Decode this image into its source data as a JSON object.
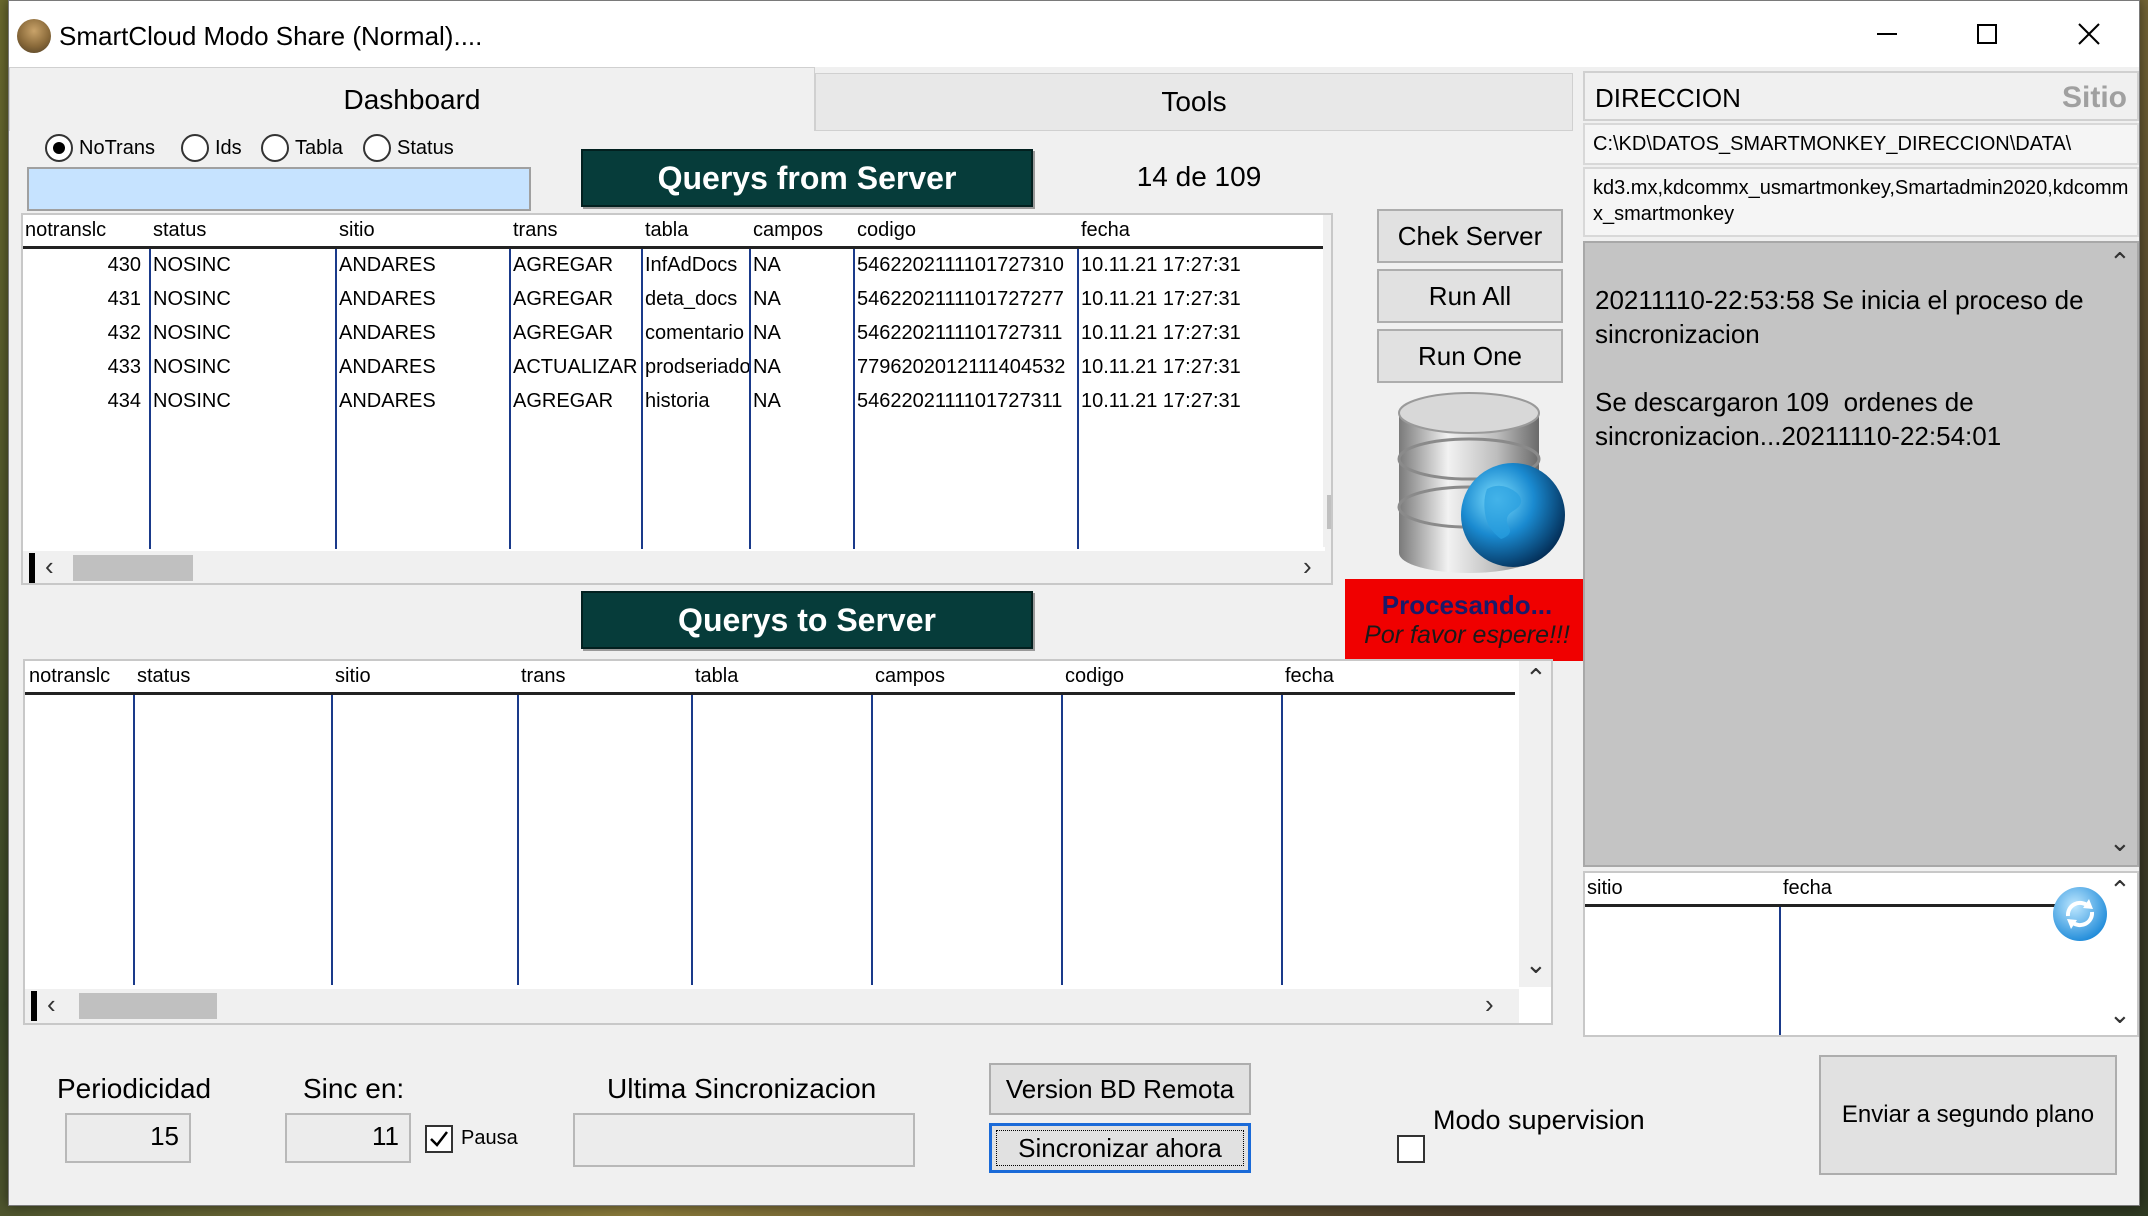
{
  "window": {
    "title": "SmartCloud Modo Share (Normal)...."
  },
  "tabs": [
    {
      "label": "Dashboard",
      "active": true
    },
    {
      "label": "Tools",
      "active": false
    }
  ],
  "filter": {
    "options": [
      "NoTrans",
      "Ids",
      "Tabla",
      "Status"
    ],
    "selected": "NoTrans",
    "input_value": ""
  },
  "from_server": {
    "title": "Querys from Server",
    "count_text": "14 de 109",
    "columns": [
      "notranslc",
      "status",
      "sitio",
      "trans",
      "tabla",
      "campos",
      "codigo",
      "fecha"
    ],
    "rows": [
      [
        "430",
        "NOSINC",
        "ANDARES",
        "AGREGAR",
        "InfAdDocs",
        "NA",
        "5462202111101727310",
        "10.11.21 17:27:31"
      ],
      [
        "431",
        "NOSINC",
        "ANDARES",
        "AGREGAR",
        "deta_docs",
        "NA",
        "5462202111101727277",
        "10.11.21 17:27:31"
      ],
      [
        "432",
        "NOSINC",
        "ANDARES",
        "AGREGAR",
        "comentario",
        "NA",
        "5462202111101727311",
        "10.11.21 17:27:31"
      ],
      [
        "433",
        "NOSINC",
        "ANDARES",
        "ACTUALIZAR",
        "prodseriado",
        "NA",
        "7796202012111404532",
        "10.11.21 17:27:31"
      ],
      [
        "434",
        "NOSINC",
        "ANDARES",
        "AGREGAR",
        "historia",
        "NA",
        "5462202111101727311",
        "10.11.21 17:27:31"
      ]
    ]
  },
  "to_server": {
    "title": "Querys to Server",
    "columns": [
      "notranslc",
      "status",
      "sitio",
      "trans",
      "tabla",
      "campos",
      "codigo",
      "fecha"
    ],
    "rows": []
  },
  "actions": {
    "check_server": "Chek Server",
    "run_all": "Run All",
    "run_one": "Run One"
  },
  "processing": {
    "title": "Procesando...",
    "subtitle": "Por favor espere!!!"
  },
  "right_panel": {
    "direction_label": "DIRECCION",
    "site_label": "Sitio",
    "data_path": "C:\\KD\\DATOS_SMARTMONKEY_DIRECCION\\DATA\\",
    "connection": "kd3.mx,kdcommx_usmartmonkey,Smartadmin2020,kdcommx_smartmonkey",
    "log": "20211110-22:53:58 Se inicia el proceso de sincronizacion\n\nSe descargaron 109  ordenes de sincronizacion...20211110-22:54:01",
    "small_grid_columns": [
      "sitio",
      "fecha"
    ]
  },
  "bottom": {
    "periodicity_label": "Periodicidad",
    "periodicity_value": "15",
    "sync_in_label": "Sinc en:",
    "sync_in_value": "11",
    "pause_label": "Pausa",
    "pause_checked": true,
    "last_sync_label": "Ultima Sincronizacion",
    "last_sync_value": "",
    "version_button": "Version BD Remota",
    "sync_now_button": "Sincronizar ahora",
    "supervision_label": "Modo supervision",
    "supervision_checked": false,
    "background_button": "Enviar a segundo plano"
  },
  "colors": {
    "banner": "#063c3a",
    "processing": "#f00000",
    "grid_lines": "#1a3a8a",
    "filter_input": "#c6e3ff",
    "log_bg": "#c4c4c4"
  }
}
